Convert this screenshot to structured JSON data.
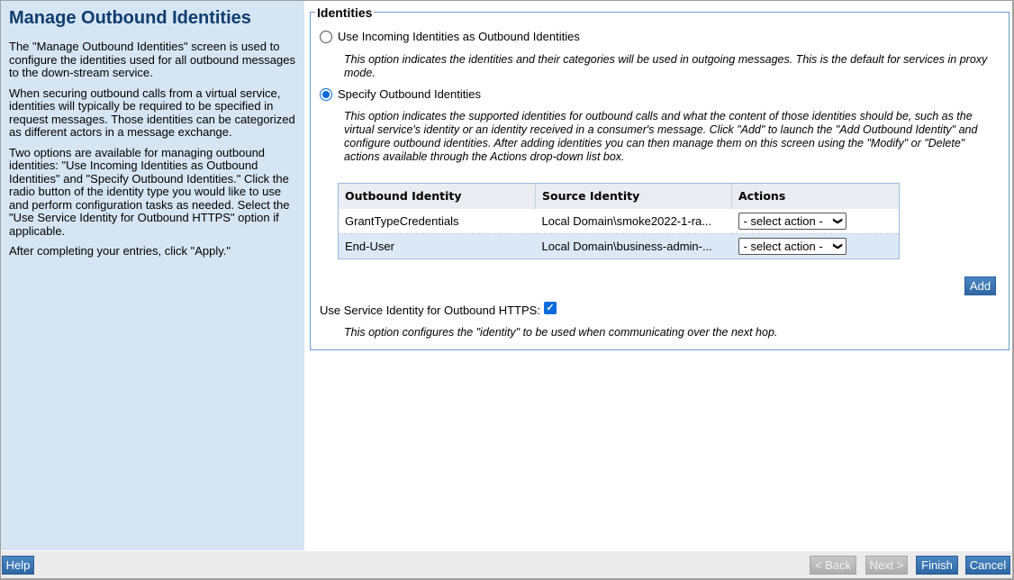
{
  "sidebar": {
    "title": "Manage Outbound Identities",
    "paragraphs": [
      "The \"Manage Outbound Identities\" screen is used to configure the identities used for all outbound messages to the down-stream service.",
      "When securing outbound calls from a virtual service, identities will typically be required to be specified in request messages. Those identities can be categorized as different actors in a message exchange.",
      "Two options are available for managing outbound identities: \"Use Incoming Identities as Outbound Identities\" and \"Specify Outbound Identities.\" Click the radio button of the identity type you would like to use and perform configuration tasks as needed. Select the \"Use Service Identity for Outbound HTTPS\" option if applicable.",
      "After completing your entries, click \"Apply.\""
    ]
  },
  "identities": {
    "legend": "Identities",
    "option_incoming": {
      "label": "Use Incoming Identities as Outbound Identities",
      "selected": false,
      "description": "This option indicates the identities and their categories will be used in outgoing messages. This is the default for services in proxy mode."
    },
    "option_specify": {
      "label": "Specify Outbound Identities",
      "selected": true,
      "description": "This option indicates the supported identities for outbound calls and what the content of those identities should be, such as the virtual service's identity or an identity received in a consumer's message. Click \"Add\" to launch the \"Add Outbound Identity\" and configure outbound identities. After adding identities you can then manage them on this screen using the \"Modify\" or \"Delete\" actions available through the Actions drop-down list box."
    },
    "table": {
      "columns": [
        "Outbound Identity",
        "Source Identity",
        "Actions"
      ],
      "rows": [
        {
          "outbound": "GrantTypeCredentials",
          "source": "Local Domain\\smoke2022-1-ra...",
          "action": "- select action -"
        },
        {
          "outbound": "End-User",
          "source": "Local Domain\\business-admin-...",
          "action": "- select action -"
        }
      ]
    },
    "add_label": "Add",
    "https": {
      "label": "Use Service Identity for Outbound HTTPS:",
      "checked": true,
      "check_glyph": "✓",
      "description": "This option configures the \"identity\" to be used when communicating over the next hop."
    }
  },
  "footer": {
    "help": "Help",
    "back": "< Back",
    "next": "Next >",
    "finish": "Finish",
    "cancel": "Cancel"
  },
  "icons": {
    "chevron": "❯"
  }
}
